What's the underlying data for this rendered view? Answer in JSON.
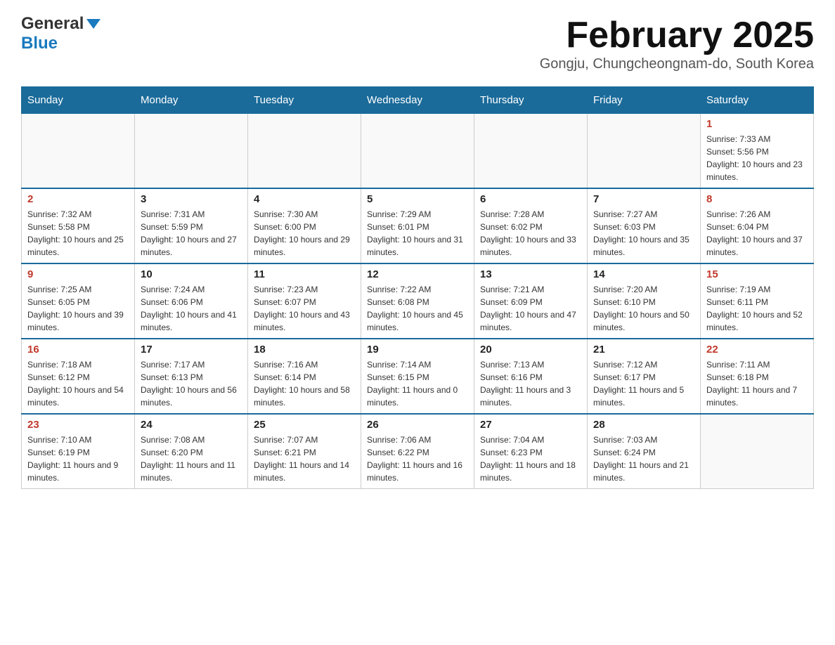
{
  "header": {
    "logo_general": "General",
    "logo_blue": "Blue",
    "month_title": "February 2025",
    "subtitle": "Gongju, Chungcheongnam-do, South Korea"
  },
  "weekdays": [
    "Sunday",
    "Monday",
    "Tuesday",
    "Wednesday",
    "Thursday",
    "Friday",
    "Saturday"
  ],
  "weeks": [
    [
      {
        "day": "",
        "sunrise": "",
        "sunset": "",
        "daylight": ""
      },
      {
        "day": "",
        "sunrise": "",
        "sunset": "",
        "daylight": ""
      },
      {
        "day": "",
        "sunrise": "",
        "sunset": "",
        "daylight": ""
      },
      {
        "day": "",
        "sunrise": "",
        "sunset": "",
        "daylight": ""
      },
      {
        "day": "",
        "sunrise": "",
        "sunset": "",
        "daylight": ""
      },
      {
        "day": "",
        "sunrise": "",
        "sunset": "",
        "daylight": ""
      },
      {
        "day": "1",
        "sunrise": "Sunrise: 7:33 AM",
        "sunset": "Sunset: 5:56 PM",
        "daylight": "Daylight: 10 hours and 23 minutes."
      }
    ],
    [
      {
        "day": "2",
        "sunrise": "Sunrise: 7:32 AM",
        "sunset": "Sunset: 5:58 PM",
        "daylight": "Daylight: 10 hours and 25 minutes."
      },
      {
        "day": "3",
        "sunrise": "Sunrise: 7:31 AM",
        "sunset": "Sunset: 5:59 PM",
        "daylight": "Daylight: 10 hours and 27 minutes."
      },
      {
        "day": "4",
        "sunrise": "Sunrise: 7:30 AM",
        "sunset": "Sunset: 6:00 PM",
        "daylight": "Daylight: 10 hours and 29 minutes."
      },
      {
        "day": "5",
        "sunrise": "Sunrise: 7:29 AM",
        "sunset": "Sunset: 6:01 PM",
        "daylight": "Daylight: 10 hours and 31 minutes."
      },
      {
        "day": "6",
        "sunrise": "Sunrise: 7:28 AM",
        "sunset": "Sunset: 6:02 PM",
        "daylight": "Daylight: 10 hours and 33 minutes."
      },
      {
        "day": "7",
        "sunrise": "Sunrise: 7:27 AM",
        "sunset": "Sunset: 6:03 PM",
        "daylight": "Daylight: 10 hours and 35 minutes."
      },
      {
        "day": "8",
        "sunrise": "Sunrise: 7:26 AM",
        "sunset": "Sunset: 6:04 PM",
        "daylight": "Daylight: 10 hours and 37 minutes."
      }
    ],
    [
      {
        "day": "9",
        "sunrise": "Sunrise: 7:25 AM",
        "sunset": "Sunset: 6:05 PM",
        "daylight": "Daylight: 10 hours and 39 minutes."
      },
      {
        "day": "10",
        "sunrise": "Sunrise: 7:24 AM",
        "sunset": "Sunset: 6:06 PM",
        "daylight": "Daylight: 10 hours and 41 minutes."
      },
      {
        "day": "11",
        "sunrise": "Sunrise: 7:23 AM",
        "sunset": "Sunset: 6:07 PM",
        "daylight": "Daylight: 10 hours and 43 minutes."
      },
      {
        "day": "12",
        "sunrise": "Sunrise: 7:22 AM",
        "sunset": "Sunset: 6:08 PM",
        "daylight": "Daylight: 10 hours and 45 minutes."
      },
      {
        "day": "13",
        "sunrise": "Sunrise: 7:21 AM",
        "sunset": "Sunset: 6:09 PM",
        "daylight": "Daylight: 10 hours and 47 minutes."
      },
      {
        "day": "14",
        "sunrise": "Sunrise: 7:20 AM",
        "sunset": "Sunset: 6:10 PM",
        "daylight": "Daylight: 10 hours and 50 minutes."
      },
      {
        "day": "15",
        "sunrise": "Sunrise: 7:19 AM",
        "sunset": "Sunset: 6:11 PM",
        "daylight": "Daylight: 10 hours and 52 minutes."
      }
    ],
    [
      {
        "day": "16",
        "sunrise": "Sunrise: 7:18 AM",
        "sunset": "Sunset: 6:12 PM",
        "daylight": "Daylight: 10 hours and 54 minutes."
      },
      {
        "day": "17",
        "sunrise": "Sunrise: 7:17 AM",
        "sunset": "Sunset: 6:13 PM",
        "daylight": "Daylight: 10 hours and 56 minutes."
      },
      {
        "day": "18",
        "sunrise": "Sunrise: 7:16 AM",
        "sunset": "Sunset: 6:14 PM",
        "daylight": "Daylight: 10 hours and 58 minutes."
      },
      {
        "day": "19",
        "sunrise": "Sunrise: 7:14 AM",
        "sunset": "Sunset: 6:15 PM",
        "daylight": "Daylight: 11 hours and 0 minutes."
      },
      {
        "day": "20",
        "sunrise": "Sunrise: 7:13 AM",
        "sunset": "Sunset: 6:16 PM",
        "daylight": "Daylight: 11 hours and 3 minutes."
      },
      {
        "day": "21",
        "sunrise": "Sunrise: 7:12 AM",
        "sunset": "Sunset: 6:17 PM",
        "daylight": "Daylight: 11 hours and 5 minutes."
      },
      {
        "day": "22",
        "sunrise": "Sunrise: 7:11 AM",
        "sunset": "Sunset: 6:18 PM",
        "daylight": "Daylight: 11 hours and 7 minutes."
      }
    ],
    [
      {
        "day": "23",
        "sunrise": "Sunrise: 7:10 AM",
        "sunset": "Sunset: 6:19 PM",
        "daylight": "Daylight: 11 hours and 9 minutes."
      },
      {
        "day": "24",
        "sunrise": "Sunrise: 7:08 AM",
        "sunset": "Sunset: 6:20 PM",
        "daylight": "Daylight: 11 hours and 11 minutes."
      },
      {
        "day": "25",
        "sunrise": "Sunrise: 7:07 AM",
        "sunset": "Sunset: 6:21 PM",
        "daylight": "Daylight: 11 hours and 14 minutes."
      },
      {
        "day": "26",
        "sunrise": "Sunrise: 7:06 AM",
        "sunset": "Sunset: 6:22 PM",
        "daylight": "Daylight: 11 hours and 16 minutes."
      },
      {
        "day": "27",
        "sunrise": "Sunrise: 7:04 AM",
        "sunset": "Sunset: 6:23 PM",
        "daylight": "Daylight: 11 hours and 18 minutes."
      },
      {
        "day": "28",
        "sunrise": "Sunrise: 7:03 AM",
        "sunset": "Sunset: 6:24 PM",
        "daylight": "Daylight: 11 hours and 21 minutes."
      },
      {
        "day": "",
        "sunrise": "",
        "sunset": "",
        "daylight": ""
      }
    ]
  ]
}
